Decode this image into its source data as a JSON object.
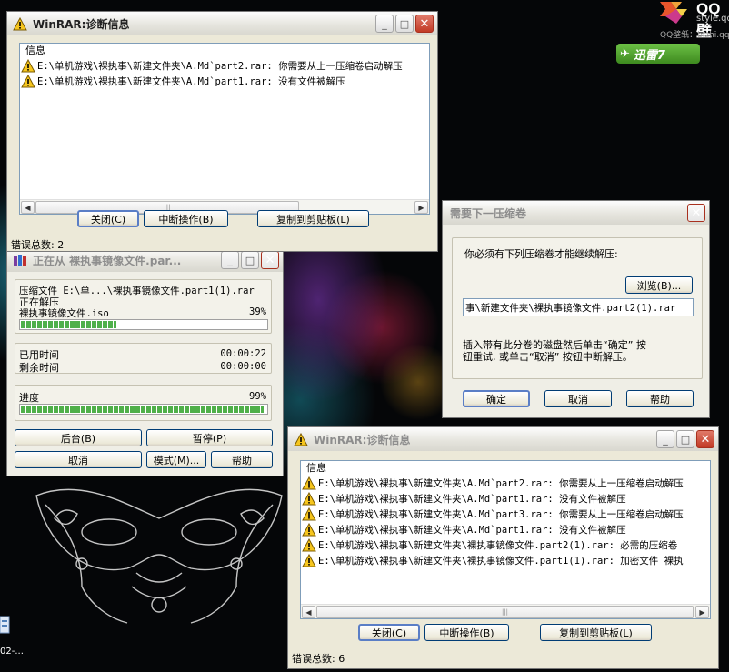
{
  "desktop": {
    "qq_title": "QQ壁",
    "qq_sub": "style.qq",
    "qq_wallpaper": "QQ壁纸：bizhi.qq",
    "xunlei_label": "迅雷7",
    "desktop_icon_label": "02-..."
  },
  "diag_top": {
    "title": "WinRAR:诊断信息",
    "column_header": "信息",
    "rows": [
      "E:\\单机游戏\\裸执事\\新建文件夹\\A.Md`part2.rar: 你需要从上一压缩卷启动解压",
      "E:\\单机游戏\\裸执事\\新建文件夹\\A.Md`part1.rar: 没有文件被解压"
    ],
    "buttons": {
      "close": "关闭(C)",
      "abort": "中断操作(B)",
      "copy": "复制到剪贴板(L)"
    },
    "status": "错误总数: 2",
    "window_buttons": {
      "minimize": "_",
      "maximize": "□",
      "close": "✕"
    }
  },
  "progress_window": {
    "title": "正在从 裸执事镜像文件.par...",
    "archive_line": "压缩文件 E:\\单...\\裸执事镜像文件.part1(1).rar",
    "action": "正在解压",
    "current_file": "裸执事镜像文件.iso",
    "file_percent_label": "39%",
    "file_progress": 0.39,
    "elapsed_label": "已用时间",
    "elapsed_value": "00:00:22",
    "remaining_label": "剩余时间",
    "remaining_value": "00:00:00",
    "total_label": "进度",
    "total_percent_label": "99%",
    "total_progress": 0.99,
    "buttons": {
      "background": "后台(B)",
      "pause": "暂停(P)",
      "cancel": "取消",
      "mode": "模式(M)...",
      "help": "帮助"
    }
  },
  "next_volume": {
    "title": "需要下一压缩卷",
    "prompt": "你必须有下列压缩卷才能继续解压:",
    "browse": "浏览(B)...",
    "path_value": "事\\新建文件夹\\裸执事镜像文件.part2(1).rar",
    "hint_line1": "插入带有此分卷的磁盘然后单击“确定” 按",
    "hint_line2": "钮重试, 或单击“取消” 按钮中断解压。",
    "buttons": {
      "ok": "确定",
      "cancel": "取消",
      "help": "帮助"
    }
  },
  "diag_bottom": {
    "title": "WinRAR:诊断信息",
    "column_header": "信息",
    "rows": [
      "E:\\单机游戏\\裸执事\\新建文件夹\\A.Md`part2.rar: 你需要从上一压缩卷启动解压",
      "E:\\单机游戏\\裸执事\\新建文件夹\\A.Md`part1.rar: 没有文件被解压",
      "E:\\单机游戏\\裸执事\\新建文件夹\\A.Md`part3.rar: 你需要从上一压缩卷启动解压",
      "E:\\单机游戏\\裸执事\\新建文件夹\\A.Md`part1.rar: 没有文件被解压",
      "E:\\单机游戏\\裸执事\\新建文件夹\\裸执事镜像文件.part2(1).rar: 必需的压缩卷",
      "E:\\单机游戏\\裸执事\\新建文件夹\\裸执事镜像文件.part1(1).rar: 加密文件 裸执"
    ],
    "buttons": {
      "close": "关闭(C)",
      "abort": "中断操作(B)",
      "copy": "复制到剪贴板(L)"
    },
    "status": "错误总数: 6",
    "window_buttons": {
      "minimize": "_",
      "maximize": "□",
      "close": "✕"
    }
  },
  "colors": {
    "progress_fill": "#4fb04a",
    "close_button": "#c23a25",
    "default_button_border": "#5a7ec6"
  }
}
